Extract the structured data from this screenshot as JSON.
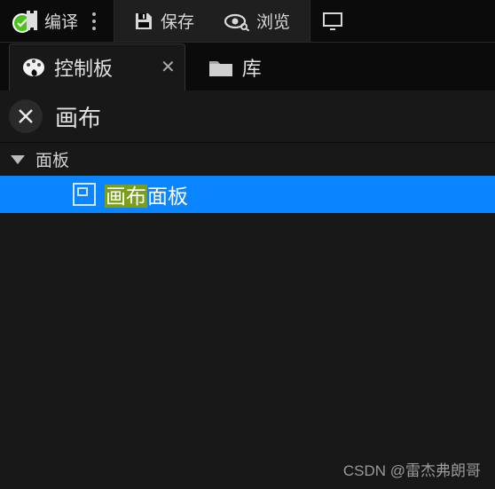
{
  "toolbar": {
    "compile": "编译",
    "save": "保存",
    "browse": "浏览"
  },
  "tabs": {
    "active": {
      "label": "控制板"
    },
    "inactive": {
      "label": "库"
    }
  },
  "search": {
    "value": "画布"
  },
  "tree": {
    "section": "面板",
    "item": {
      "highlight": "画布",
      "rest": "面板"
    }
  },
  "watermark": "CSDN @雷杰弗朗哥"
}
